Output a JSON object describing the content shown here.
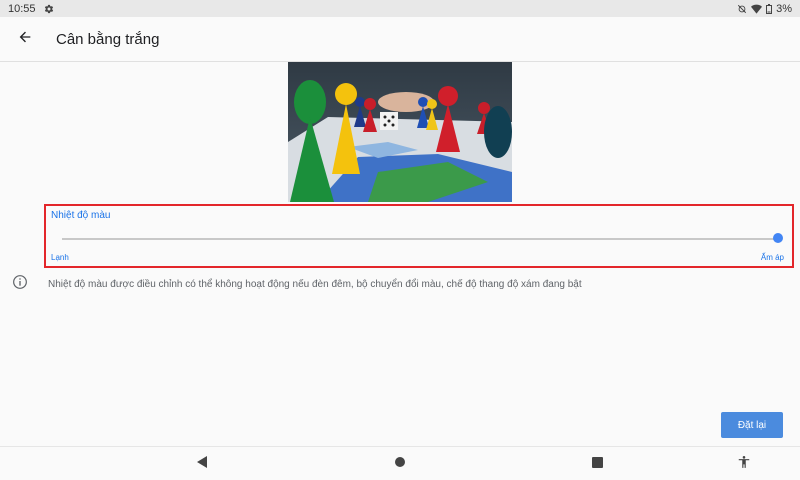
{
  "status_bar": {
    "time": "10:55",
    "battery": "3%"
  },
  "app_bar": {
    "title": "Cân bằng trắng"
  },
  "slider": {
    "label": "Nhiệt độ màu",
    "min_label": "Lạnh",
    "max_label": "Ấm áp",
    "value": 1.0
  },
  "info": {
    "text": "Nhiệt độ màu được điều chỉnh có thể không hoạt động nếu đèn đêm, bộ chuyển đổi màu, chế độ thang độ xám đang bật"
  },
  "reset_button": {
    "label": "Đặt lại"
  },
  "colors": {
    "accent": "#4285f4",
    "highlight_box": "#e3262a",
    "reset_button": "#4b8bde"
  },
  "icons": {
    "settings": "gear-icon",
    "back": "arrow-back-icon",
    "info": "info-icon",
    "nav_back": "triangle-back-icon",
    "nav_home": "circle-home-icon",
    "nav_recents": "square-recents-icon",
    "accessibility": "accessibility-icon"
  }
}
